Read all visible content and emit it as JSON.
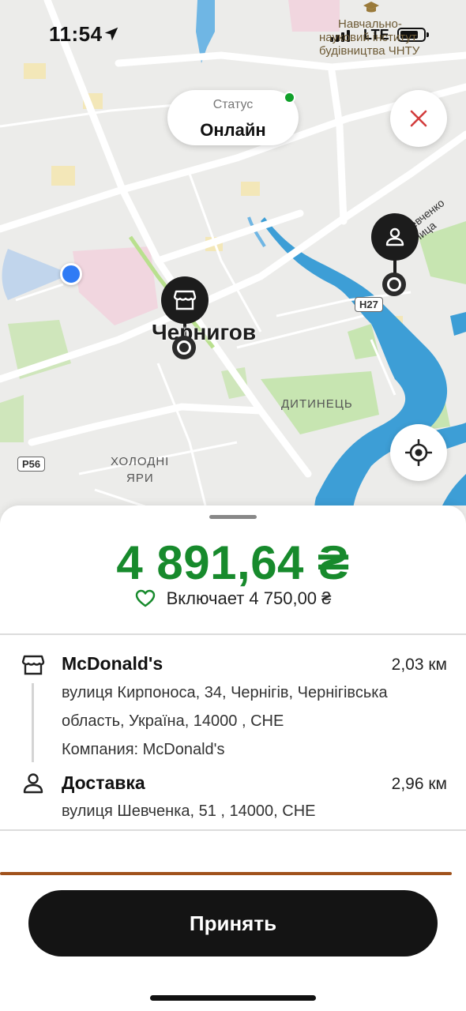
{
  "status_bar": {
    "time": "11:54",
    "network": "LTE"
  },
  "map": {
    "status_label": "Статус",
    "status_value": "Онлайн",
    "city_label": "Чернигов",
    "district_1": "ДИТИНЕЦЬ",
    "district_2": "ХОЛОДНІ",
    "district_3": "ЯРИ",
    "street_label": "Шевченко улица",
    "poi_line1": "Навчально-",
    "poi_line2": "науковий інститут",
    "poi_line3": "будівництва ЧНТУ",
    "road_h27": "H27",
    "road_p56": "P56",
    "colors": {
      "water": "#3d9ed6",
      "park": "#bfe0a8",
      "status_online": "#10a02a"
    }
  },
  "order": {
    "price": "4 891,64 ₴",
    "includes": "Включает 4 750,00 ₴",
    "pickup": {
      "title": "McDonald's",
      "distance": "2,03 км",
      "address_line1": "вулиця Кирпоноса, 34, Чернігів, Чернігівська",
      "address_line2": "область, Україна, 14000 , CHE",
      "company": "Компания: McDonald's",
      "icon": "store-icon"
    },
    "dropoff": {
      "title": "Доставка",
      "distance": "2,96 км",
      "address": "вулиця Шевченка, 51 , 14000, CHE",
      "icon": "person-icon"
    },
    "accept_label": "Принять",
    "price_color": "#178a2c"
  }
}
